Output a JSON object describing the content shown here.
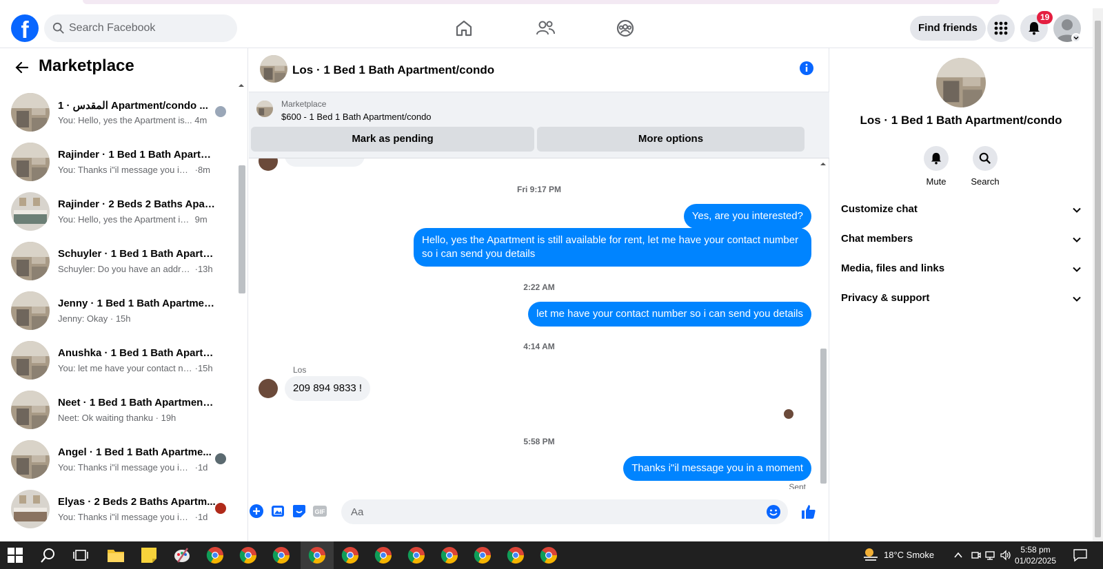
{
  "header": {
    "search_placeholder": "Search Facebook",
    "find_friends_label": "Find friends",
    "notification_count": "19"
  },
  "sidebar": {
    "title": "Marketplace",
    "conversations": [
      {
        "title": "المقدس · 1 Apartment/condo ...",
        "preview": "You: Hello, yes the Apartment is...",
        "time": "4m"
      },
      {
        "title": "Rajinder · 1 Bed 1 Bath Apartme...",
        "preview": "You: Thanks i\"il message you in a ...",
        "time": "8m"
      },
      {
        "title": "Rajinder · 2 Beds 2 Baths Apart...",
        "preview": "You: Hello, yes the Apartment is sti...",
        "time": "9m"
      },
      {
        "title": "Schuyler · 1 Bed 1 Bath Apartme...",
        "preview": "Schuyler: Do you have an address...",
        "time": "13h"
      },
      {
        "title": "Jenny · 1 Bed 1 Bath Apartment/...",
        "preview": "Jenny: Okay",
        "time": "15h"
      },
      {
        "title": "Anushka · 1 Bed 1 Bath Apartme...",
        "preview": "You: let me have your contact nu...",
        "time": "15h"
      },
      {
        "title": "Neet · 1 Bed 1 Bath Apartment/c...",
        "preview": "Neet: Ok waiting thanku",
        "time": "19h"
      },
      {
        "title": "Angel · 1 Bed 1 Bath Apartme...",
        "preview": "You: Thanks i\"il message you in ...",
        "time": "1d"
      },
      {
        "title": "Elyas · 2 Beds 2 Baths Apartm...",
        "preview": "You: Thanks i\"il message you in ...",
        "time": "1d"
      }
    ]
  },
  "chat": {
    "title": "Los · 1 Bed 1 Bath Apartment/condo",
    "marketplace_label": "Marketplace",
    "listing": "$600 - 1 Bed 1 Bath Apartment/condo",
    "mark_pending_label": "Mark as pending",
    "more_options_label": "More options",
    "messages": {
      "ts1": "Fri 9:17 PM",
      "out1": "Yes, are you interested?",
      "out2": "Hello, yes the Apartment is still available for rent, let me have your contact number so i can send you details",
      "ts2": "2:22 AM",
      "out3": "let me have your contact number so i can send you details",
      "ts3": "4:14 AM",
      "in_sender": "Los",
      "in1": "209 894 9833 !",
      "ts4": "5:58 PM",
      "out4": "Thanks i\"il message you in a moment",
      "status": "Sent"
    },
    "composer_placeholder": "Aa"
  },
  "right_panel": {
    "name": "Los · 1 Bed 1 Bath Apartment/condo",
    "mute_label": "Mute",
    "search_label": "Search",
    "sections": [
      "Customize chat",
      "Chat members",
      "Media, files and links",
      "Privacy & support"
    ]
  },
  "taskbar": {
    "weather": "18°C  Smoke",
    "time": "5:58 pm",
    "date": "01/02/2025"
  },
  "colors": {
    "accent": "#0866ff",
    "bubble": "#0084ff",
    "badge": "#e41e3f"
  }
}
